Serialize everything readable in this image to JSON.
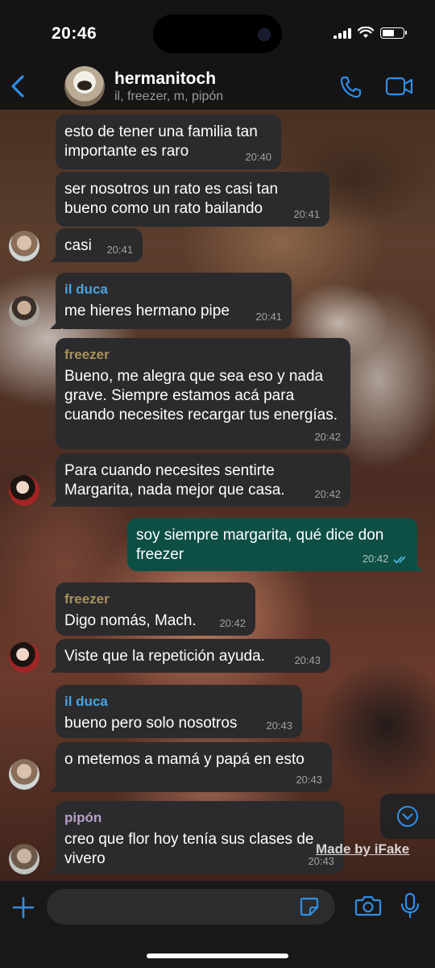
{
  "status_bar": {
    "time": "20:46",
    "battery_level": 0.6
  },
  "header": {
    "back_label": "",
    "title": "hermanitoch",
    "subtitle": "il, freezer, m, pipón",
    "call_icon": "phone-icon",
    "video_icon": "video-camera-icon"
  },
  "messages": [
    {
      "text": "esto de tener una familia tan importante es raro",
      "time": "20:40"
    },
    {
      "text": "ser nosotros un rato es casi tan bueno como un rato bailando",
      "time": "20:41"
    },
    {
      "text": "casi",
      "time": "20:41"
    },
    {
      "sender": "il duca",
      "text": "me hieres hermano pipe",
      "time": "20:41"
    },
    {
      "sender": "freezer",
      "text": "Bueno, me alegra que sea eso y nada grave. Siempre estamos acá para cuando necesites recargar tus energías.",
      "time": "20:42"
    },
    {
      "text": "Para cuando necesites sentirte Margarita, nada mejor que casa.",
      "time": "20:42"
    },
    {
      "text": "soy siempre margarita, qué dice don freezer",
      "time": "20:42",
      "outgoing": true,
      "read": true
    },
    {
      "sender": "freezer",
      "text": "Digo nomás, Mach.",
      "time": "20:42"
    },
    {
      "text": "Viste que la repetición ayuda.",
      "time": "20:43"
    },
    {
      "sender": "il duca",
      "text": "bueno pero solo nosotros",
      "time": "20:43"
    },
    {
      "text": "o metemos a mamá y papá en esto",
      "time": "20:43"
    },
    {
      "sender": "pipón",
      "text": "creo que flor hoy tenía sus clases de vivero",
      "time": "20:43"
    }
  ],
  "sender_colors": {
    "il duca": "#4aa3df",
    "freezer": "#a8925a",
    "pipón": "#b79fc9"
  },
  "composer": {
    "placeholder": ""
  },
  "watermark": "Made by iFake",
  "colors": {
    "accent": "#2f8fe6",
    "outgoing_bubble": "#0d4f44",
    "incoming_bubble": "#2b2b2d"
  }
}
